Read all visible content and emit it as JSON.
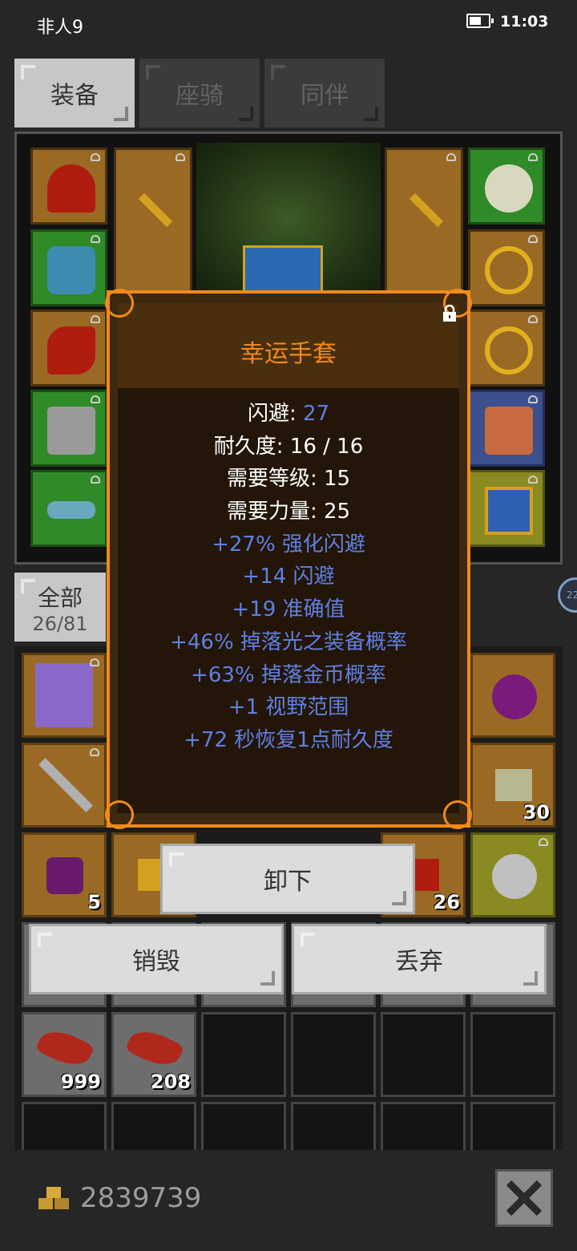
{
  "status_bar": {
    "carrier": "非人9",
    "time": "11:03",
    "battery_level": 0.75
  },
  "tabs": [
    {
      "label": "装备",
      "active": true
    },
    {
      "label": "座骑",
      "active": false
    },
    {
      "label": "同伴",
      "active": false
    }
  ],
  "equipment_slots": [
    {
      "item": "red-helmet-icon",
      "color": "orange"
    },
    {
      "item": "blue-armor-icon",
      "color": "green"
    },
    {
      "item": "red-glove-icon",
      "color": "orange"
    },
    {
      "item": "iron-boots-icon",
      "color": "green"
    },
    {
      "item": "belt-icon",
      "color": "green"
    },
    {
      "item": "golden-sword-icon",
      "color": "orange"
    },
    {
      "item": "golden-dagger-icon",
      "color": "orange"
    },
    {
      "item": "silver-amulet-icon",
      "color": "green"
    },
    {
      "item": "gold-ring-icon",
      "color": "orange"
    },
    {
      "item": "gold-ring-icon",
      "color": "orange"
    },
    {
      "item": "scroll-icon",
      "color": "blue"
    },
    {
      "item": "treasure-chest-icon",
      "color": "yellow"
    }
  ],
  "inventory": {
    "filter_label": "全部",
    "count": "26/81",
    "item_counts": [
      "5",
      "26",
      "30",
      "999",
      "208"
    ]
  },
  "tooltip": {
    "title": "幸运手套",
    "stats": [
      {
        "label": "闪避: ",
        "value": "27"
      },
      {
        "label": "耐久度: 16 / 16",
        "value": ""
      },
      {
        "label": "需要等级: 15",
        "value": ""
      },
      {
        "label": "需要力量: 25",
        "value": ""
      }
    ],
    "bonuses": [
      "+27% 强化闪避",
      "+14 闪避",
      "+19 准确值",
      "+46% 掉落光之装备概率",
      "+63% 掉落金币概率",
      "+1 视野范围",
      "+72 秒恢复1点耐久度"
    ]
  },
  "actions": {
    "unequip": "卸下",
    "destroy": "销毁",
    "discard": "丢弃"
  },
  "footer": {
    "gold": "2839739"
  },
  "colors": {
    "accent_orange": "#f08a1c",
    "bonus_blue": "#5f7fe3",
    "rare_green": "#2f8a28"
  }
}
